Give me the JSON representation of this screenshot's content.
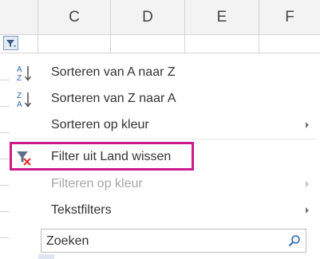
{
  "columns": [
    "C",
    "D",
    "E",
    "F"
  ],
  "menu": {
    "items": [
      {
        "label": "Sorteren van A naar Z",
        "icon": "sort-ascending-icon",
        "enabled": true,
        "submenu": false
      },
      {
        "label": "Sorteren van Z naar A",
        "icon": "sort-descending-icon",
        "enabled": true,
        "submenu": false
      },
      {
        "label": "Sorteren op kleur",
        "icon": "",
        "enabled": true,
        "submenu": true
      },
      {
        "label": "Filter uit Land wissen",
        "icon": "clear-filter-icon",
        "enabled": true,
        "submenu": false,
        "highlighted": true
      },
      {
        "label": "Filteren op kleur",
        "icon": "",
        "enabled": false,
        "submenu": true
      },
      {
        "label": "Tekstfilters",
        "icon": "",
        "enabled": true,
        "submenu": true
      }
    ],
    "search_placeholder": "Zoeken"
  },
  "colors": {
    "highlight_border": "#cc1a8c",
    "disabled_text": "#a6a6a6",
    "clear_filter_x": "#e03030"
  }
}
